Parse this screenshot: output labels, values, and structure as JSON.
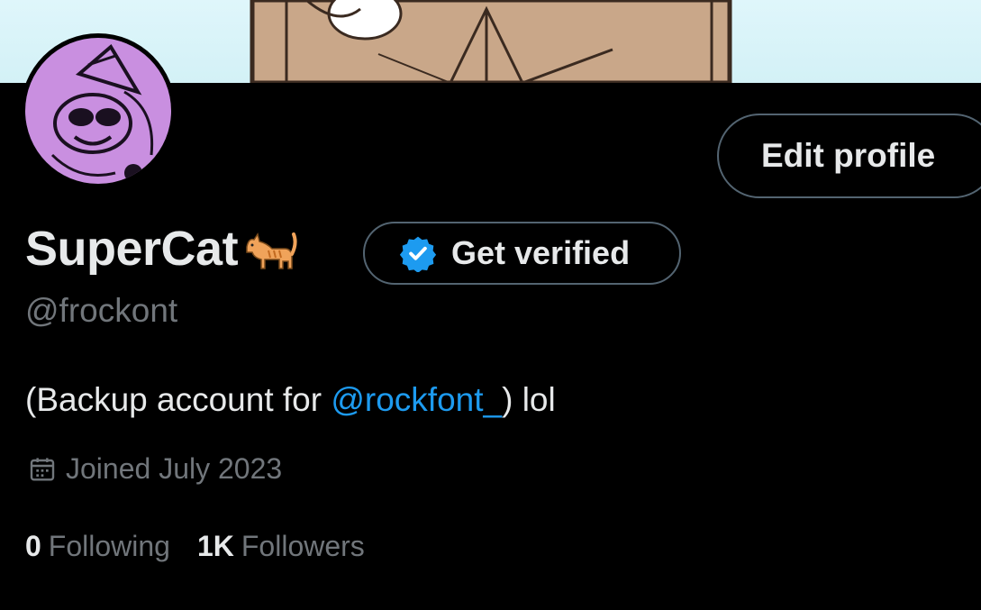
{
  "profile": {
    "display_name": "SuperCat",
    "name_emoji": "cat-emoji",
    "handle": "@frockont",
    "bio_prefix": "(Backup account for ",
    "bio_mention": "@rockfont_",
    "bio_suffix": ") lol",
    "joined": "Joined July 2023"
  },
  "buttons": {
    "edit_profile": "Edit profile",
    "get_verified": "Get verified"
  },
  "stats": {
    "following_count": "0",
    "following_label": "Following",
    "followers_count": "1K",
    "followers_label": "Followers"
  },
  "icons": {
    "verified": "verified-badge-icon",
    "calendar": "calendar-icon"
  },
  "colors": {
    "background": "#000000",
    "accent": "#1d9bf0",
    "muted": "#71767b",
    "avatar_bg": "#c98fe0"
  }
}
